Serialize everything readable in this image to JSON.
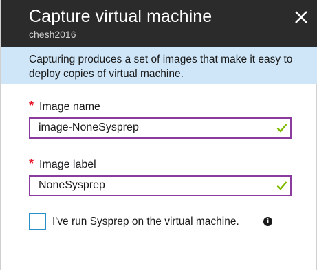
{
  "header": {
    "title": "Capture virtual machine",
    "subtitle": "chesh2016"
  },
  "info_banner": {
    "text": "Capturing produces a set of images that make it easy to deploy copies of virtual machine."
  },
  "fields": [
    {
      "label": "Image name",
      "required_mark": "*",
      "value": "image-NoneSysprep",
      "valid": true
    },
    {
      "label": "Image label",
      "required_mark": "*",
      "value": "NoneSysprep",
      "valid": true
    }
  ],
  "sysprep_checkbox": {
    "label": "I've run Sysprep on the virtual machine.",
    "checked": false,
    "info_icon_glyph": "i"
  },
  "colors": {
    "header_bg": "#2b2b2b",
    "info_bg": "#cfe6f8",
    "input_border": "#8a3b9e",
    "required": "#e81123",
    "valid_check": "#7fba00",
    "checkbox_border": "#2a8fc7"
  },
  "icons": {
    "close": "close-icon",
    "valid": "checkmark-icon",
    "info": "info-icon"
  }
}
